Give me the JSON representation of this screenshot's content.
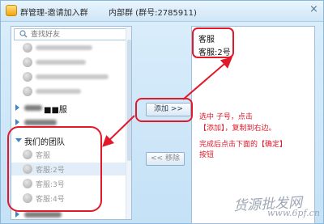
{
  "titlebar": {
    "title": "群管理-邀请加入群",
    "subtitle": "内部群 (群号:2785911)",
    "close_label": "×"
  },
  "search": {
    "placeholder": "查找好友"
  },
  "left_list": {
    "group_blurred_label": "■■服",
    "team_group_label": "我们的团队",
    "members": [
      "客服",
      "客服:2号",
      "客服:3号",
      "客服:4号"
    ]
  },
  "buttons": {
    "add_label": "添加 >>",
    "remove_label": "<< 移除"
  },
  "right_list": {
    "items": [
      "客服",
      "客服:2号"
    ]
  },
  "notes": {
    "line1": "选中 子号，点击",
    "line2": "【添加】，复制到右边。",
    "line3": "完成后点击下面的【确定】",
    "line4": "按钮"
  },
  "watermark": {
    "text": "货源批发网",
    "url": "www.6pf.cn"
  },
  "colors": {
    "annotation_red": "#e0192b",
    "title_bg": "#cfe6f7"
  }
}
